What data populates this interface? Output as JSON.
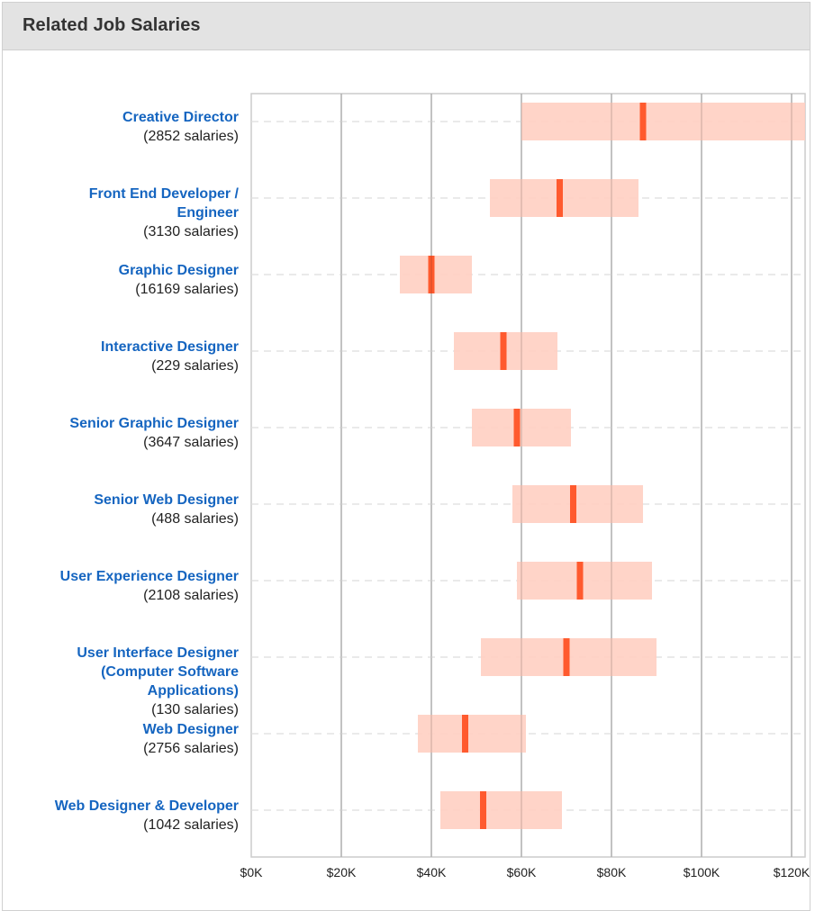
{
  "panel": {
    "title": "Related Job Salaries"
  },
  "colors": {
    "range_fill": "#ffcfc2",
    "median_mark": "#ff5a2e",
    "link": "#1565c0",
    "grid": "#c8c8c8",
    "dashed": "#dddddd"
  },
  "chart_data": {
    "type": "bar",
    "subtype": "salary-range",
    "title": "Related Job Salaries",
    "xlabel": "",
    "ylabel": "",
    "xlim": [
      0,
      123000
    ],
    "x_ticks": [
      0,
      20000,
      40000,
      60000,
      80000,
      100000,
      120000
    ],
    "x_tick_labels": [
      "$0K",
      "$20K",
      "$40K",
      "$60K",
      "$80K",
      "$100K",
      "$120K"
    ],
    "grid": true,
    "categories": [
      {
        "name_lines": [
          "Creative Director"
        ],
        "count_label": "(2852 salaries)",
        "low": 60000,
        "median": 87000,
        "high": 123000
      },
      {
        "name_lines": [
          "Front End Developer /",
          "Engineer"
        ],
        "count_label": "(3130 salaries)",
        "low": 53000,
        "median": 68500,
        "high": 86000
      },
      {
        "name_lines": [
          "Graphic Designer"
        ],
        "count_label": "(16169 salaries)",
        "low": 33000,
        "median": 40000,
        "high": 49000
      },
      {
        "name_lines": [
          "Interactive Designer"
        ],
        "count_label": "(229 salaries)",
        "low": 45000,
        "median": 56000,
        "high": 68000
      },
      {
        "name_lines": [
          "Senior Graphic Designer"
        ],
        "count_label": "(3647 salaries)",
        "low": 49000,
        "median": 59000,
        "high": 71000
      },
      {
        "name_lines": [
          "Senior Web Designer"
        ],
        "count_label": "(488 salaries)",
        "low": 58000,
        "median": 71500,
        "high": 87000
      },
      {
        "name_lines": [
          "User Experience Designer"
        ],
        "count_label": "(2108 salaries)",
        "low": 59000,
        "median": 73000,
        "high": 89000
      },
      {
        "name_lines": [
          "User Interface Designer",
          "(Computer Software",
          "Applications)"
        ],
        "count_label": "(130 salaries)",
        "low": 51000,
        "median": 70000,
        "high": 90000
      },
      {
        "name_lines": [
          "Web Designer"
        ],
        "count_label": "(2756 salaries)",
        "low": 37000,
        "median": 47500,
        "high": 61000
      },
      {
        "name_lines": [
          "Web Designer & Developer"
        ],
        "count_label": "(1042 salaries)",
        "low": 42000,
        "median": 51500,
        "high": 69000
      }
    ]
  }
}
